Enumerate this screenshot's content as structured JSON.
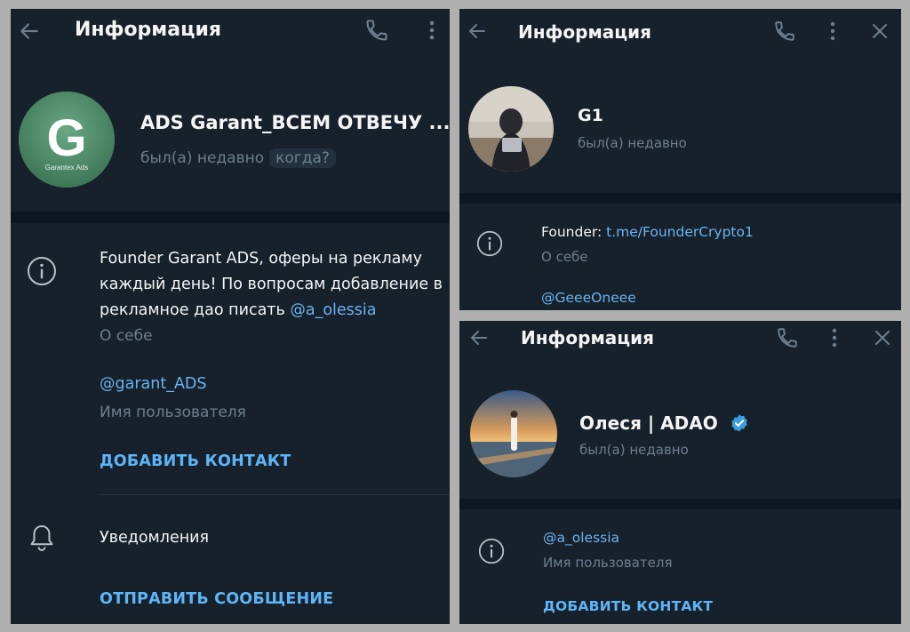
{
  "panel1": {
    "header": {
      "title": "Информация"
    },
    "profile": {
      "name": "ADS Garant_ВСЕМ ОТВЕЧУ ...",
      "status": "был(а) недавно",
      "status_badge": "когда?",
      "avatar": {
        "letter": "G",
        "caption": "Garantex Ads",
        "color": "#4e8f6a"
      }
    },
    "bio": {
      "line1": "Founder Garant ADS, оферы на рекламу",
      "line2": "каждый день! По вопросам добавление в",
      "line3_prefix": "рекламное дао писать ",
      "line3_link": "@a_olessia",
      "caption": "О себе"
    },
    "username": {
      "value": "@garant_ADS",
      "caption": "Имя пользователя"
    },
    "add_contact": "ДОБАВИТЬ КОНТАКТ",
    "notifications": "Уведомления",
    "send_message": "ОТПРАВИТЬ СООБЩЕНИЕ"
  },
  "panel2": {
    "header": {
      "title": "Информация"
    },
    "profile": {
      "name": "G1",
      "status": "был(а) недавно"
    },
    "bio": {
      "prefix": "Founder: ",
      "link": "t.me/FounderCrypto1",
      "caption": "О себе"
    },
    "username": {
      "value": "@GeeeOneee"
    }
  },
  "panel3": {
    "header": {
      "title": "Информация"
    },
    "profile": {
      "name": "Олеся | ADAO",
      "status": "был(а) недавно",
      "verified": true
    },
    "username": {
      "value": "@a_olessia",
      "caption": "Имя пользователя"
    },
    "add_contact": "ДОБАВИТЬ КОНТАКТ"
  },
  "colors": {
    "panel_bg": "#17212b",
    "separator": "#0e1621",
    "link": "#6ab3f3",
    "accent": "#5eb5f7",
    "muted": "#6d7f8f",
    "frame_bg": "#b0b0b0"
  },
  "icons": [
    "back-arrow-icon",
    "phone-icon",
    "more-vertical-icon",
    "close-icon",
    "info-icon",
    "bell-icon",
    "verified-icon"
  ]
}
